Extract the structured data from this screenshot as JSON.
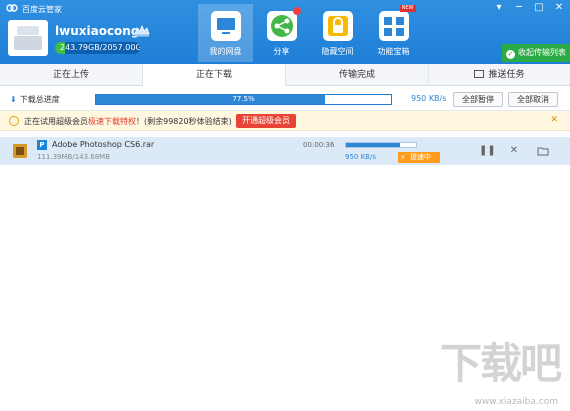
{
  "window": {
    "title": "百度云管家",
    "controls": [
      "▾",
      "─",
      "□",
      "✕"
    ]
  },
  "user": {
    "name": "lwuxiaocong",
    "quota_text": "243.79GB/2057.00GB",
    "quota_fraction": 0.1185
  },
  "nav": [
    {
      "label": "我的网盘",
      "icon": "desktop-icon"
    },
    {
      "label": "分享",
      "icon": "share-icon"
    },
    {
      "label": "隐藏空间",
      "icon": "lock-icon"
    },
    {
      "label": "功能宝箱",
      "icon": "toolbox-icon",
      "badge": "NEW"
    }
  ],
  "received_button": "收起传输列表",
  "tabs": [
    "正在上传",
    "正在下载",
    "传输完成",
    "推送任务"
  ],
  "total": {
    "label": "下载总进度",
    "percent_text": "77.5%",
    "progress": 0.775,
    "speed": "950 KB/s",
    "pause_all": "全部暂停",
    "cancel_all": "全部取消"
  },
  "notice": {
    "text_before": "正在试用超级会员",
    "text_red": "极速下载特权",
    "text_after": "！(剩余99820秒体验结束)",
    "button": "开通超级会员",
    "close": "✕"
  },
  "download": {
    "badge": "P",
    "name": "Adobe Photoshop CS6.rar",
    "size": "111.39MB/143.68MB",
    "time": "00:00:36",
    "progress": 0.775,
    "speed": "950 KB/s",
    "boost": "提速中",
    "actions": [
      "pause-icon",
      "close-icon",
      "folder-icon"
    ]
  },
  "watermark": {
    "text": "下载吧",
    "url": "www.xiazaiba.com"
  },
  "colors": {
    "header": "#2f8fe0",
    "accent": "#2d86d6",
    "green": "#2bab45",
    "red": "#e84435",
    "orange": "#ff9d1a"
  }
}
